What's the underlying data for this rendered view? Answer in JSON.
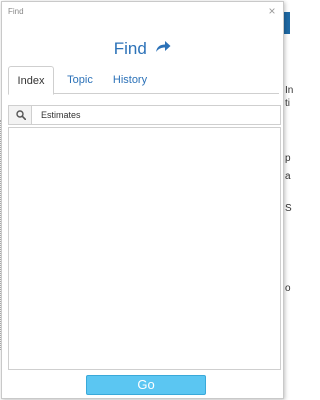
{
  "dialog": {
    "title": "Find",
    "close_glyph": "×",
    "heading": "Find",
    "heading_icon": "share-arrow-icon"
  },
  "tabs": [
    {
      "label": "Index",
      "active": true
    },
    {
      "label": "Topic",
      "active": false
    },
    {
      "label": "History",
      "active": false
    }
  ],
  "search": {
    "icon": "search-icon",
    "value": "Estimates"
  },
  "go_label": "Go",
  "backdrop": {
    "chars": [
      "In",
      "ti",
      "p",
      "a",
      "S",
      "o"
    ]
  },
  "colors": {
    "accent": "#2c72b8",
    "go_button": "#5bc6f2",
    "backdrop_bar": "#1f6aa5"
  }
}
